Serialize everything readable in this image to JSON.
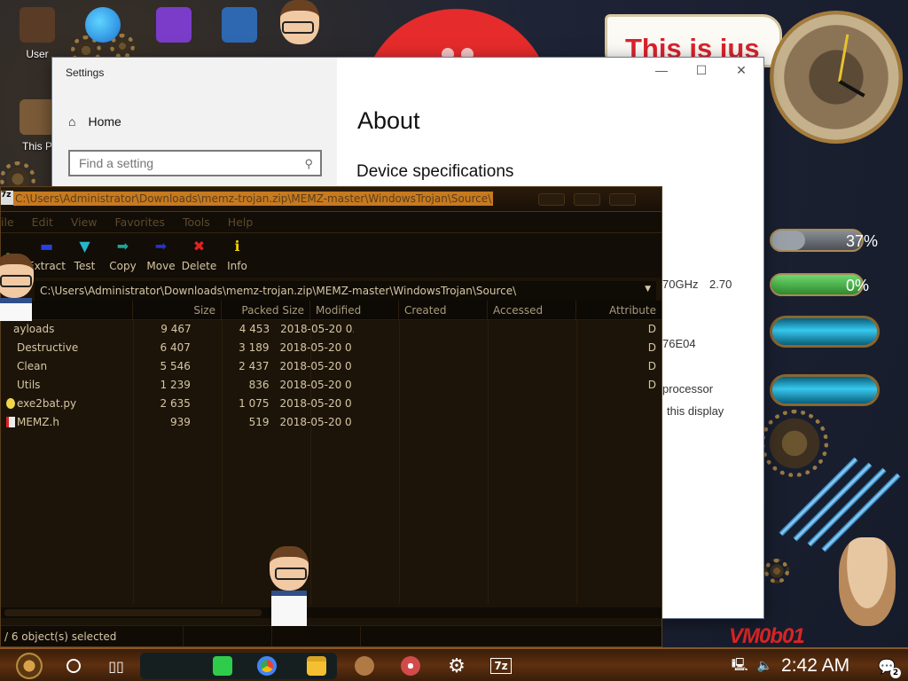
{
  "desktop": {
    "icons": [
      {
        "name": "user-folder",
        "label": "User"
      },
      {
        "name": "this-pc",
        "label": "This P"
      }
    ],
    "banner_text": "This is jus",
    "meters": [
      {
        "label": "37%",
        "level": 0.37,
        "color": "#9aa0a8"
      },
      {
        "label": "0%",
        "level": 0.0,
        "color": "#3fb34a"
      }
    ],
    "vm_tag": "VM0b01"
  },
  "settings": {
    "window_title": "Settings",
    "nav_home": "Home",
    "search_placeholder": "Find a setting",
    "page_title": "About",
    "section_title": "Device specifications",
    "fragments": [
      "70GHz",
      "2.70",
      "76E04",
      "processor",
      "this display"
    ],
    "controls": {
      "minimize": "—",
      "maximize": "☐",
      "close": "✕"
    }
  },
  "sevenzip": {
    "title": "C:\\Users\\Administrator\\Downloads\\memz-trojan.zip\\MEMZ-master\\WindowsTrojan\\Source\\",
    "menu": [
      "ile",
      "Edit",
      "View",
      "Favorites",
      "Tools",
      "Help"
    ],
    "toolbar": [
      {
        "label": "",
        "icon": "add-icon",
        "glyph": "✚",
        "color": "#2fc42f"
      },
      {
        "label": "Extract",
        "icon": "extract-icon",
        "glyph": "▬",
        "color": "#2a3fe0"
      },
      {
        "label": "Test",
        "icon": "test-icon",
        "glyph": "▼",
        "color": "#25b7c9"
      },
      {
        "label": "Copy",
        "icon": "copy-icon",
        "glyph": "➡",
        "color": "#1aa59a"
      },
      {
        "label": "Move",
        "icon": "move-icon",
        "glyph": "➡",
        "color": "#2533c8"
      },
      {
        "label": "Delete",
        "icon": "delete-icon",
        "glyph": "✖",
        "color": "#e02222"
      },
      {
        "label": "Info",
        "icon": "info-icon",
        "glyph": "ℹ",
        "color": "#f0d000"
      }
    ],
    "address": "C:\\Users\\Administrator\\Downloads\\memz-trojan.zip\\MEMZ-master\\WindowsTrojan\\Source\\",
    "columns": [
      "",
      "Size",
      "Packed Size",
      "Modified",
      "Created",
      "Accessed",
      "Attribute"
    ],
    "rows": [
      {
        "name": "ayloads",
        "size": "9 467",
        "packed": "4 453",
        "modified": "2018-05-20 0...",
        "attr": "D",
        "type": "folder"
      },
      {
        "name": "Destructive",
        "size": "6 407",
        "packed": "3 189",
        "modified": "2018-05-20 0...",
        "attr": "D",
        "type": "folder"
      },
      {
        "name": "Clean",
        "size": "5 546",
        "packed": "2 437",
        "modified": "2018-05-20 0...",
        "attr": "D",
        "type": "folder"
      },
      {
        "name": "Utils",
        "size": "1 239",
        "packed": "836",
        "modified": "2018-05-20 0...",
        "attr": "D",
        "type": "folder"
      },
      {
        "name": "exe2bat.py",
        "size": "2 635",
        "packed": "1 075",
        "modified": "2018-05-20 0...",
        "attr": "",
        "type": "python"
      },
      {
        "name": "MEMZ.h",
        "size": "939",
        "packed": "519",
        "modified": "2018-05-20 0...",
        "attr": "",
        "type": "header"
      }
    ],
    "status": "/ 6 object(s) selected"
  },
  "taskbar": {
    "time": "2:42 AM",
    "notification_count": "2",
    "apps": [
      {
        "name": "sticky-notes-icon",
        "glyph": "≡",
        "color": "#2ecc4a"
      },
      {
        "name": "chrome-icon",
        "glyph": "◉",
        "color": "#e94235"
      },
      {
        "name": "file-explorer-icon",
        "glyph": "▆",
        "color": "#f4c031"
      },
      {
        "name": "hamster-app-icon",
        "glyph": "●",
        "color": "#b07a45"
      },
      {
        "name": "memz-app-icon",
        "glyph": "◔",
        "color": "#d34a4a"
      },
      {
        "name": "settings-gear-icon",
        "glyph": "⚙",
        "color": "#ffffff"
      },
      {
        "name": "sevenzip-icon",
        "glyph": "7z",
        "color": "#ffffff"
      }
    ]
  }
}
